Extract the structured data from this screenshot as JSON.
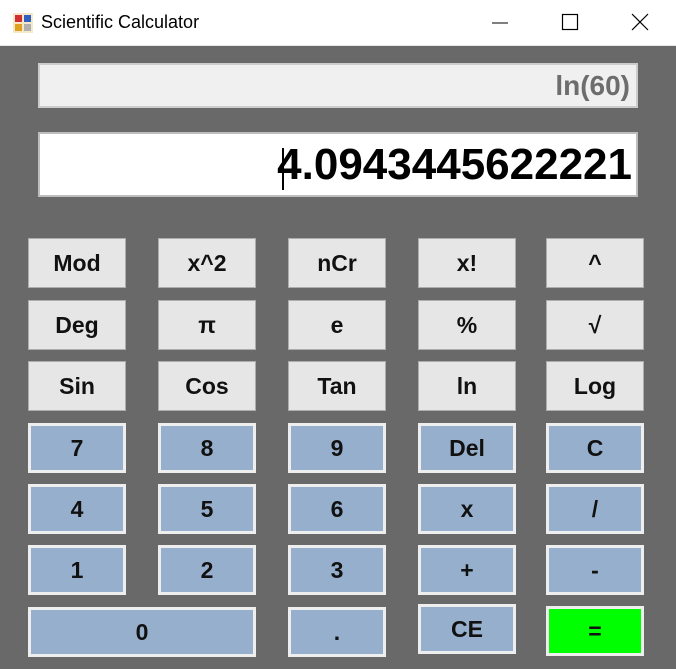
{
  "window": {
    "title": "Scientific Calculator",
    "icon": "app-icon"
  },
  "display": {
    "expression": "ln(60)",
    "result": "4.0943445622221"
  },
  "buttons": {
    "mod": "Mod",
    "square": "x^2",
    "ncr": "nCr",
    "factorial": "x!",
    "power": "^",
    "deg": "Deg",
    "pi": "π",
    "e": "e",
    "percent": "%",
    "sqrt": "√",
    "sin": "Sin",
    "cos": "Cos",
    "tan": "Tan",
    "ln": "ln",
    "log": "Log",
    "seven": "7",
    "eight": "8",
    "nine": "9",
    "del": "Del",
    "clear": "C",
    "four": "4",
    "five": "5",
    "six": "6",
    "multiply": "x",
    "divide": "/",
    "one": "1",
    "two": "2",
    "three": "3",
    "plus": "+",
    "minus": "-",
    "zero": "0",
    "decimal": ".",
    "ce": "CE",
    "equals": "="
  },
  "colors": {
    "background": "#696969",
    "function_button": "#e6e6e6",
    "number_button": "#96afcd",
    "equals_button": "#00ff00"
  }
}
